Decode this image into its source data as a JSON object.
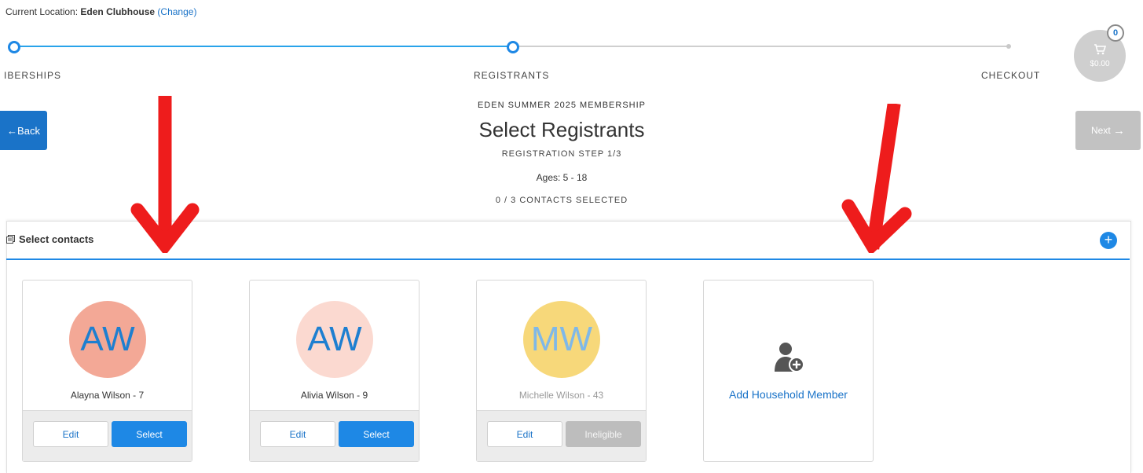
{
  "location": {
    "prefix": "Current Location:",
    "name": "Eden Clubhouse",
    "change": "(Change)"
  },
  "progress": {
    "steps": [
      "IBERSHIPS",
      "REGISTRANTS",
      "CHECKOUT"
    ]
  },
  "cart": {
    "count": "0",
    "total": "$0.00"
  },
  "nav": {
    "back": "Back",
    "next": "Next"
  },
  "header": {
    "membership": "EDEN SUMMER 2025 MEMBERSHIP",
    "title": "Select Registrants",
    "step": "REGISTRATION STEP 1/3",
    "ages": "Ages: 5 - 18",
    "count": "0 / 3 CONTACTS SELECTED"
  },
  "panel": {
    "title": "Select contacts"
  },
  "contacts": [
    {
      "initials": "AW",
      "name": "Alayna Wilson - 7",
      "edit": "Edit",
      "action": "Select"
    },
    {
      "initials": "AW",
      "name": "Alivia Wilson - 9",
      "edit": "Edit",
      "action": "Select"
    },
    {
      "initials": "MW",
      "name": "Michelle Wilson - 43",
      "edit": "Edit",
      "action": "Ineligible"
    }
  ],
  "add_member": {
    "label": "Add Household Member"
  },
  "colors": {
    "accent": "#1e88e5",
    "avatar1": "#f3a896",
    "avatar2": "#fbd9d0",
    "avatar3": "#f7d87a",
    "arrow": "#ee1c1c"
  }
}
